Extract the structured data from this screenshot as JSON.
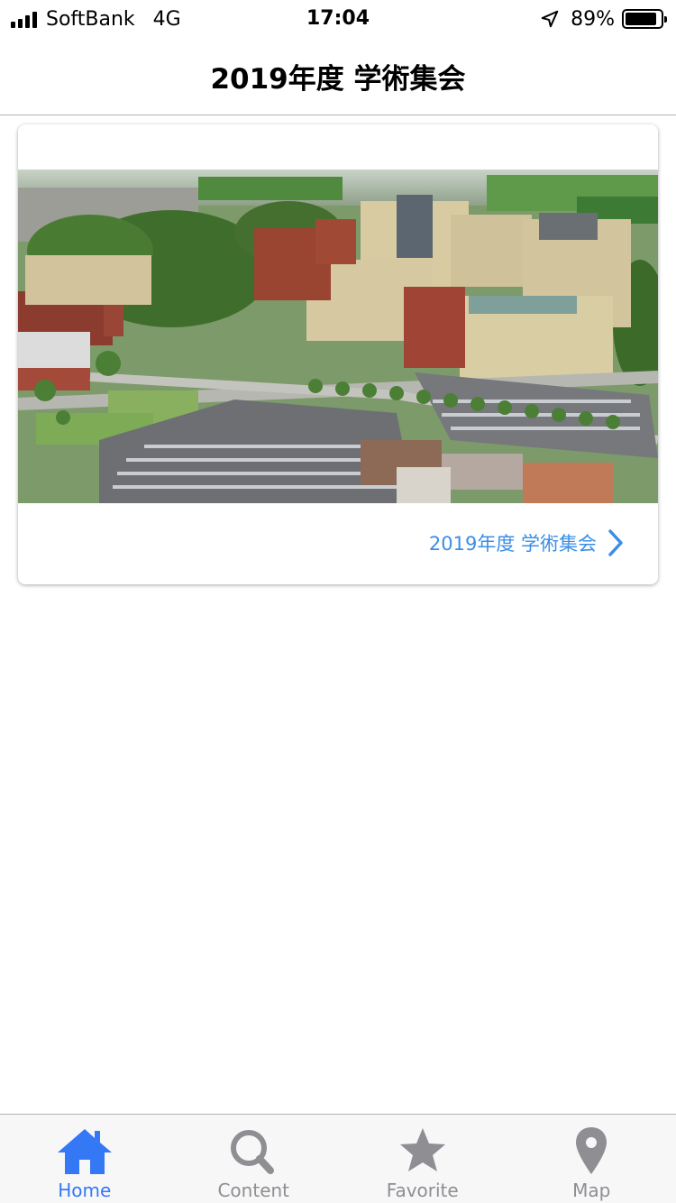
{
  "status_bar": {
    "carrier": "SoftBank",
    "network": "4G",
    "time": "17:04",
    "battery_percent": "89%",
    "battery_level": 0.89
  },
  "nav": {
    "title": "2019年度 学術集会"
  },
  "card": {
    "link_label": "2019年度 学術集会",
    "image_icon": "campus-aerial-photo"
  },
  "tabs": [
    {
      "label": "Home",
      "icon": "home-icon",
      "active": true
    },
    {
      "label": "Content",
      "icon": "search-icon",
      "active": false
    },
    {
      "label": "Favorite",
      "icon": "star-icon",
      "active": false
    },
    {
      "label": "Map",
      "icon": "map-pin-icon",
      "active": false
    }
  ],
  "colors": {
    "accent": "#3478f6",
    "link": "#3a8ee6",
    "tab_inactive": "#8e8e93"
  }
}
